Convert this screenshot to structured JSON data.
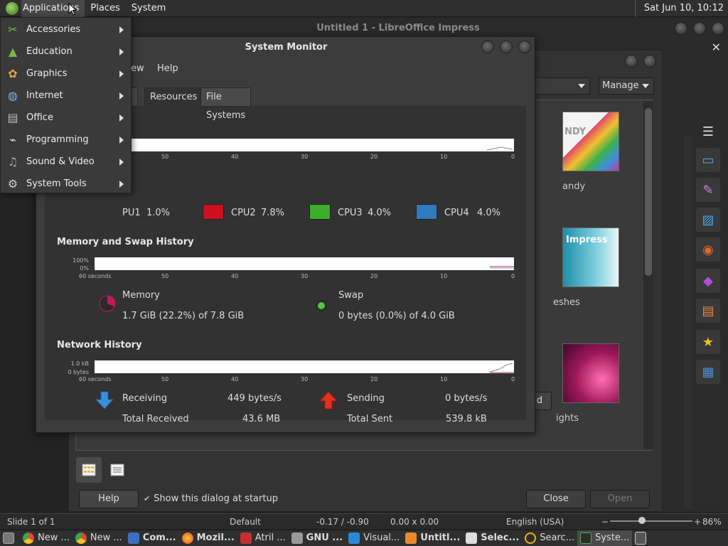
{
  "top_panel": {
    "menus": [
      "Applications",
      "Places",
      "System"
    ],
    "clock": "Sat Jun 10, 10:12"
  },
  "apps_menu": {
    "items": [
      {
        "label": "Accessories",
        "icon": "accessories-icon"
      },
      {
        "label": "Education",
        "icon": "education-icon"
      },
      {
        "label": "Graphics",
        "icon": "graphics-icon"
      },
      {
        "label": "Internet",
        "icon": "internet-icon"
      },
      {
        "label": "Office",
        "icon": "office-icon"
      },
      {
        "label": "Programming",
        "icon": "programming-icon"
      },
      {
        "label": "Sound & Video",
        "icon": "sound-video-icon"
      },
      {
        "label": "System Tools",
        "icon": "system-tools-icon"
      }
    ]
  },
  "impress": {
    "title": "Untitled 1 - LibreOffice Impress"
  },
  "template_dialog": {
    "manage_label": "Manage",
    "templates": [
      {
        "label": "andy"
      },
      {
        "label": "eshes"
      },
      {
        "label": "ights"
      }
    ],
    "thumb2_text": "Impress",
    "thumb1_text": "NDY",
    "help_label": "Help",
    "show_startup_label": "Show this dialog at startup",
    "close_label": "Close",
    "open_label": "Open",
    "partial_button_label": "d"
  },
  "system_monitor": {
    "title": "System Monitor",
    "menu": [
      "ew",
      "Help"
    ],
    "tabs": [
      "es",
      "Resources",
      "File Systems"
    ],
    "active_tab": "Resources",
    "axis": [
      "50",
      "40",
      "30",
      "20",
      "10",
      "0"
    ],
    "axis_start": "60 seconds",
    "cpu": [
      {
        "name": "CPU1",
        "value": "1.0%",
        "color": "#000000"
      },
      {
        "name": "CPU2",
        "value": "7.8%",
        "color": "#cc1020"
      },
      {
        "name": "CPU3",
        "value": "4.0%",
        "color": "#3cad2c"
      },
      {
        "name": "CPU4",
        "value": "4.0%",
        "color": "#2f7ac0"
      }
    ],
    "cpu1_label_visible": "PU1",
    "memory": {
      "section_title": "Memory and Swap History",
      "y_max": "100%",
      "y_min": "0%",
      "memory_label": "Memory",
      "memory_value": "1.7 GiB (22.2%) of 7.8 GiB",
      "swap_label": "Swap",
      "swap_value": "0 bytes (0.0%) of 4.0 GiB"
    },
    "network": {
      "section_title": "Network History",
      "y_max": "1.0 kB",
      "y_min": "0 bytes",
      "receiving_label": "Receiving",
      "receiving_value": "449 bytes/s",
      "total_received_label": "Total Received",
      "total_received_value": "43.6 MB",
      "sending_label": "Sending",
      "sending_value": "0 bytes/s",
      "total_sent_label": "Total Sent",
      "total_sent_value": "539.8 kB"
    }
  },
  "statusbar": {
    "slide": "Slide 1 of 1",
    "layout": "Default",
    "position": "-0.17 / -0.90",
    "size": "0.00 x 0.00",
    "language": "English (USA)",
    "zoom": "86%"
  },
  "taskbar": {
    "tasks": [
      {
        "label": "New ...",
        "color": "#e94435"
      },
      {
        "label": "New ...",
        "color": "#e94435"
      },
      {
        "label": "Com...",
        "color": "#3d6fc0"
      },
      {
        "label": "Mozil...",
        "color": "#f07a1e"
      },
      {
        "label": "Atril ...",
        "color": "#c43030"
      },
      {
        "label": "GNU ...",
        "color": "#999999"
      },
      {
        "label": "Visual...",
        "color": "#2a8ad8"
      },
      {
        "label": "Untitl...",
        "color": "#e98b2c"
      },
      {
        "label": "Selec...",
        "color": "#dddddd"
      },
      {
        "label": "Searc...",
        "color": "#e6b800"
      },
      {
        "label": "Syste...",
        "color": "#4caf50"
      }
    ]
  }
}
